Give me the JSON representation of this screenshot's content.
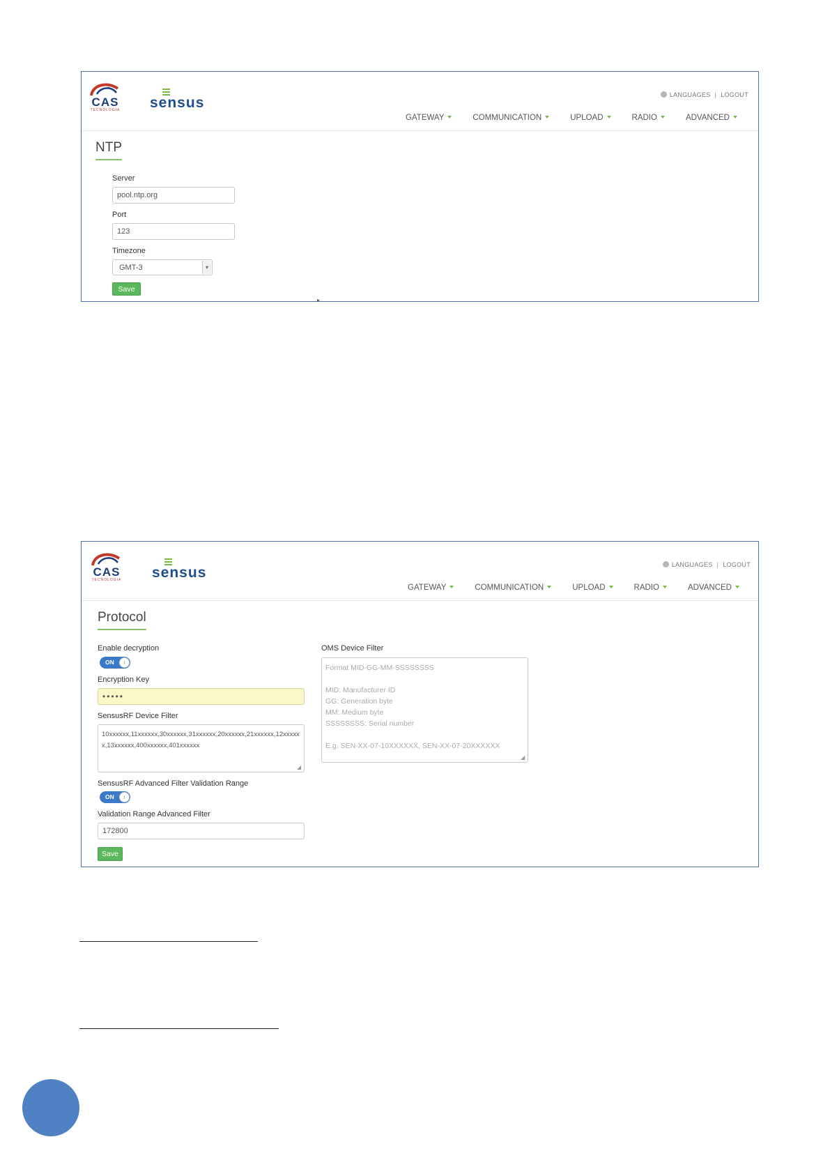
{
  "brand": {
    "cas": "CAS",
    "cas_sub": "TECNOLOGIA",
    "sensus": "sensus"
  },
  "header": {
    "languages": "LANGUAGES",
    "logout": "LOGOUT",
    "nav": [
      "GATEWAY",
      "COMMUNICATION",
      "UPLOAD",
      "RADIO",
      "ADVANCED"
    ]
  },
  "ntp": {
    "title": "NTP",
    "server_label": "Server",
    "server_value": "pool.ntp.org",
    "port_label": "Port",
    "port_value": "123",
    "timezone_label": "Timezone",
    "timezone_value": "GMT-3",
    "save": "Save"
  },
  "protocol": {
    "title": "Protocol",
    "enable_decryption_label": "Enable decryption",
    "enable_decryption_state": "ON",
    "encryption_key_label": "Encryption Key",
    "encryption_key_value": "•••••",
    "sensusrf_filter_label": "SensusRF Device Filter",
    "sensusrf_filter_value": "10xxxxxx,11xxxxxx,30xxxxxx,31xxxxxx,20xxxxxx,21xxxxxx,12xxxxxx,13xxxxxx,400xxxxxx,401xxxxxx",
    "advanced_filter_label": "SensusRF Advanced Filter Validation Range",
    "advanced_filter_state": "ON",
    "validation_range_label": "Validation Range Advanced Filter",
    "validation_range_value": "172800",
    "oms_filter_label": "OMS Device Filter",
    "oms_placeholder_lines": [
      "Format MID-GG-MM-SSSSSSSS",
      "",
      "MID: Manufacturer ID",
      "GG: Generation byte",
      "MM: Medium byte",
      "SSSSSSSS: Serial number",
      "",
      "E.g. SEN-XX-07-10XXXXXX, SEN-XX-07-20XXXXXX"
    ],
    "save": "Save"
  },
  "colors": {
    "frame_border": "#4a6fa5",
    "accent_green": "#7ab648",
    "save_green": "#5cb85c",
    "toggle_blue": "#3a7ac8",
    "page_circle": "#4f81c4"
  }
}
